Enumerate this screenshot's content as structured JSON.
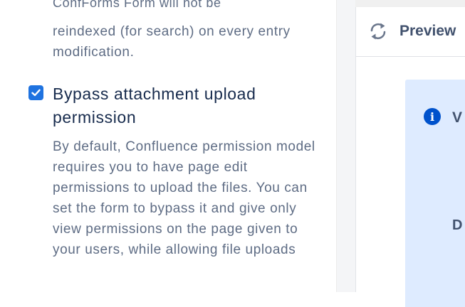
{
  "settings": {
    "previous_option": {
      "description_cut": "ConfForms Form will not be",
      "description": "reindexed (for search) on every entry modification."
    },
    "bypass_option": {
      "checked": true,
      "label": "Bypass attachment upload permission",
      "description": "By default, Confluence permission model requires you to have page edit permissions to upload the files. You can set the form to bypass it and give only view permissions on the page given to your users, while allowing file uploads"
    }
  },
  "preview": {
    "refresh_icon": "refresh-icon",
    "title": "Preview",
    "info": {
      "icon": "info-icon",
      "title_fragment": "V",
      "body_fragment": "D"
    }
  },
  "colors": {
    "accent": "#1f73e0",
    "info_panel": "#deebff",
    "info_icon": "#0052cc",
    "text_primary": "#172b4d",
    "text_secondary": "#5e6c84"
  }
}
